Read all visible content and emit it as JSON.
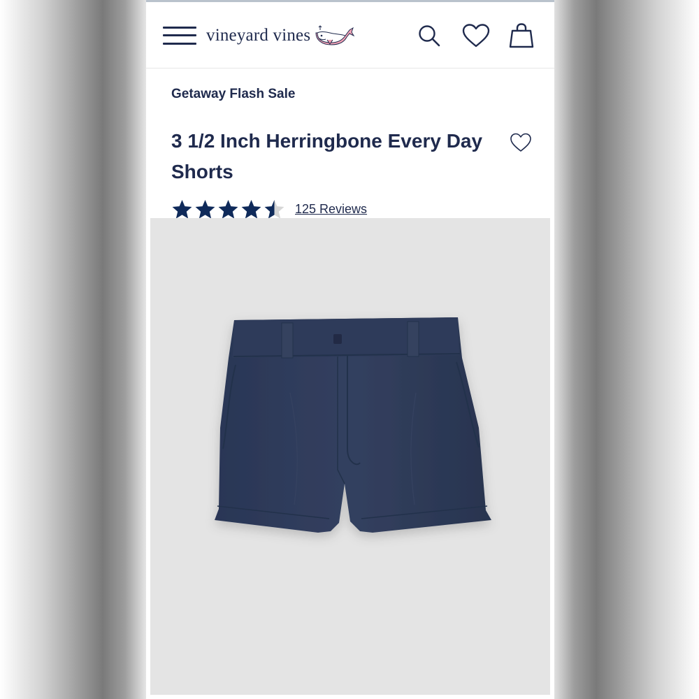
{
  "header": {
    "menu_icon": "hamburger-menu-icon",
    "brand_name": "vineyard vines",
    "logo_icon": "whale-logo-icon",
    "search_icon": "search-icon",
    "wishlist_icon": "heart-icon",
    "bag_icon": "shopping-bag-icon"
  },
  "product": {
    "promo_label": "Getaway Flash Sale",
    "title": "3 1/2 Inch Herringbone Every Day Shorts",
    "wishlist_icon": "heart-outline-icon",
    "rating": 4.5,
    "rating_max": 5,
    "reviews_link": "125 Reviews",
    "image": "navy-shorts-product-image"
  },
  "colors": {
    "navy": "#1f2a4d",
    "star_navy": "#0f2a5a",
    "whale_pink": "#f3a3b5",
    "image_bg": "#e4e4e4",
    "shorts_navy": "#2e3b5b"
  }
}
